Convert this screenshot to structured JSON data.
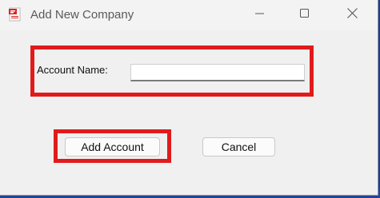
{
  "window": {
    "title": "Add New Company",
    "app_icon": "app-document-icon",
    "controls": {
      "minimize_icon": "minimize-icon",
      "maximize_icon": "maximize-icon",
      "close_icon": "close-icon"
    }
  },
  "form": {
    "account_name_label": "Account Name:",
    "account_name_value": "",
    "account_name_placeholder": ""
  },
  "buttons": {
    "add_account_label": "Add Account",
    "cancel_label": "Cancel"
  },
  "highlights": {
    "color": "#e11b1b"
  }
}
